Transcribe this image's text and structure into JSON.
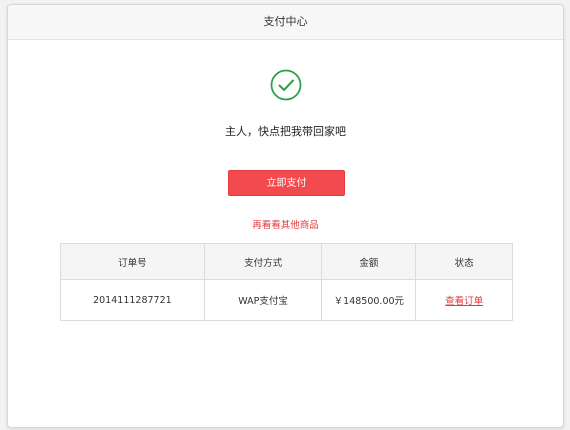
{
  "header": {
    "title": "支付中心"
  },
  "result": {
    "icon": "check-circle-icon",
    "accent_color": "#2aa14b",
    "message": "主人，快点把我带回家吧"
  },
  "actions": {
    "pay_now_label": "立即支付",
    "more_products_label": "再看看其他商品",
    "button_color": "#f24a4f",
    "link_color": "#e4393c"
  },
  "order_table": {
    "headers": [
      "订单号",
      "支付方式",
      "金额",
      "状态"
    ],
    "rows": [
      {
        "order_no": "2014111287721",
        "payment_method": "WAP支付宝",
        "amount": "￥148500.00元",
        "status_link": "查看订单"
      }
    ]
  }
}
